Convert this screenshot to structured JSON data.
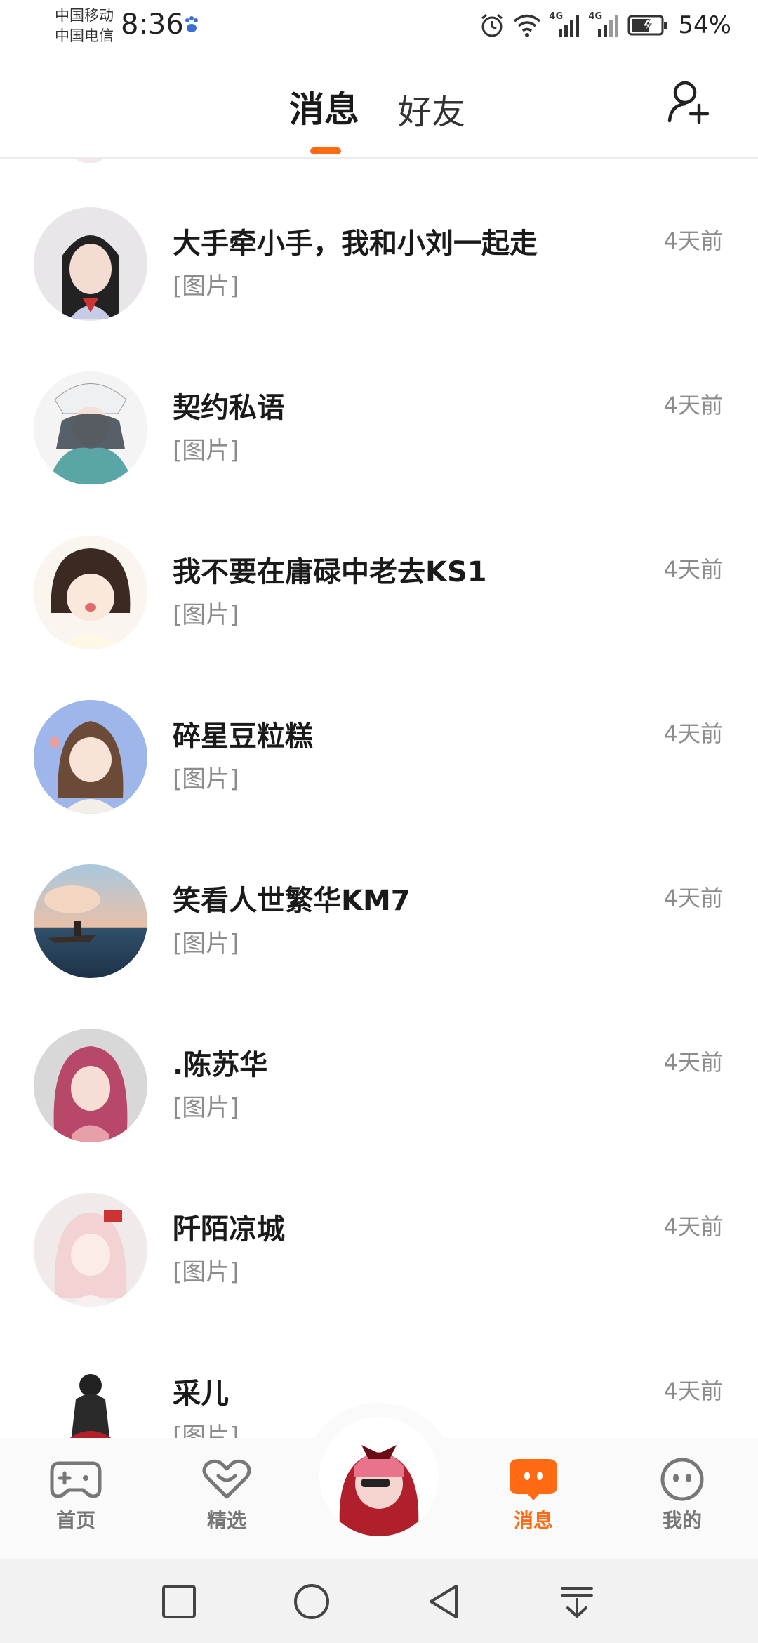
{
  "status_bar": {
    "carrier_1": "中国移动",
    "carrier_2": "中国电信",
    "time": "8:36",
    "battery": "54%",
    "net_1": "4G",
    "net_2": "4G"
  },
  "header": {
    "tabs": [
      {
        "label": "消息",
        "active": true
      },
      {
        "label": "好友",
        "active": false
      }
    ],
    "accent_color": "#ff6a13",
    "add_friend_icon": "add-user-icon"
  },
  "conversations": [
    {
      "name": "大手牵小手，我和小刘一起走",
      "preview": "[图片]",
      "time": "4天前"
    },
    {
      "name": "契约私语",
      "preview": "[图片]",
      "time": "4天前"
    },
    {
      "name": "我不要在庸碌中老去KS1",
      "preview": "[图片]",
      "time": "4天前"
    },
    {
      "name": "碎星豆粒糕",
      "preview": "[图片]",
      "time": "4天前"
    },
    {
      "name": "笑看人世繁华KM7",
      "preview": "[图片]",
      "time": "4天前"
    },
    {
      "name": ".陈苏华",
      "preview": "[图片]",
      "time": "4天前"
    },
    {
      "name": "阡陌凉城",
      "preview": "[图片]",
      "time": "4天前"
    },
    {
      "name": "采儿",
      "preview": "[图片]",
      "time": "4天前"
    }
  ],
  "bottom_nav": {
    "items": [
      {
        "label": "首页",
        "icon": "gamepad-icon"
      },
      {
        "label": "精选",
        "icon": "heart-icon"
      },
      {
        "label": "消息",
        "icon": "chat-bubble-icon",
        "active": true
      },
      {
        "label": "我的",
        "icon": "face-icon"
      }
    ]
  },
  "system_nav": {
    "icons": [
      "recent-apps-icon",
      "home-icon",
      "back-icon",
      "notification-pull-icon"
    ]
  }
}
